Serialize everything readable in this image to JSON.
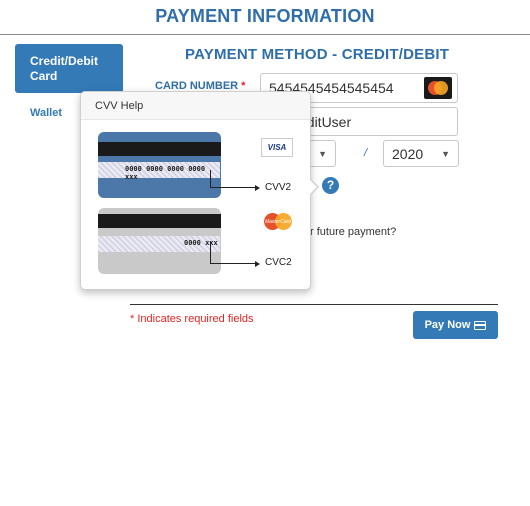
{
  "page": {
    "title": "PAYMENT INFORMATION"
  },
  "tabs": [
    {
      "label": "Credit/Debit Card",
      "active": true
    },
    {
      "label": "Wallet",
      "active": false
    }
  ],
  "form": {
    "section_title": "PAYMENT METHOD - CREDIT/DEBIT",
    "card_number_label": "CARD NUMBER",
    "required_marker": "*",
    "card_number_value": "5454545454545454",
    "card_brand_icon": "mastercard-icon",
    "name_value": "editUser",
    "expiry_month_value": "",
    "expiry_separator": "/",
    "expiry_year_value": "2020",
    "save_text": "r future payment?",
    "required_note": "* Indicates required fields",
    "pay_button_label": "Pay Now"
  },
  "cvv_popover": {
    "title": "CVV Help",
    "visa_card_number": "0000 0000 0000 0000 xxx",
    "visa_label": "CVV2",
    "visa_logo_text": "VISA",
    "mc_card_number": "0000 xxx",
    "mc_label": "CVC2",
    "mc_logo_text": "MasterCard"
  },
  "colors": {
    "accent": "#337ab7",
    "title": "#2f6ea8",
    "required": "#e02424"
  }
}
